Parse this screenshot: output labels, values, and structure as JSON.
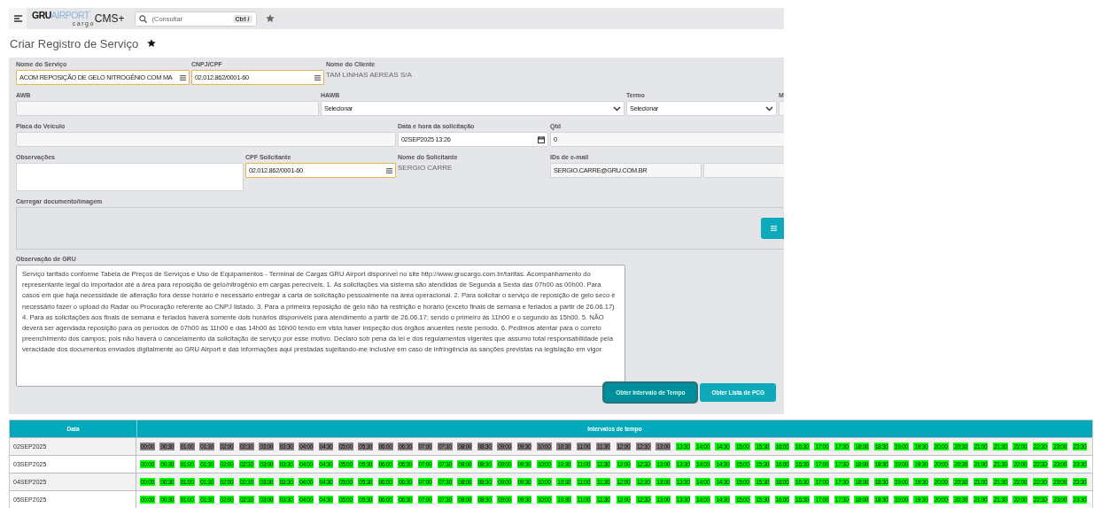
{
  "topbar": {
    "logo": {
      "brand": "GRU",
      "product": "AIRPORT",
      "sub": "cargo"
    },
    "app_name": "CMS+",
    "search": {
      "placeholder": "(Consultar",
      "shortcut": "Ctrl /"
    }
  },
  "page_title": "Criar Registro de Serviço",
  "form_rows": [
    {
      "kind": "fields",
      "fields": [
        {
          "label": "Nome do Serviço",
          "kind": "lookup",
          "value": "ACOM REPOSIÇÃO DE GELO NITROGÊNIO COM MA",
          "highlighted": true
        },
        {
          "label": "CNPJ/CPF",
          "kind": "lookup",
          "value": "02.012.862/0001-60",
          "highlighted": true
        },
        {
          "label": "Nome do Cliente",
          "kind": "static",
          "value": "TAM LINHAS AEREAS S/A"
        }
      ]
    },
    {
      "kind": "fields",
      "fields": [
        {
          "label": "AWB",
          "kind": "text",
          "highlighted": false
        },
        {
          "label": "HAWB",
          "kind": "select",
          "value": "Selecionar",
          "highlighted": false
        },
        {
          "label": "Termo",
          "kind": "select",
          "value": "Selecionar",
          "highlighted": false
        },
        {
          "label": "M",
          "kind": "text",
          "highlighted": false
        }
      ]
    },
    {
      "kind": "fields",
      "fields": [
        {
          "label": "Placa do Veículo",
          "kind": "text",
          "highlighted": false
        },
        {
          "label": "Data e hora da solicitação",
          "kind": "date",
          "value": "02SEP2025 13:26",
          "highlighted": false
        },
        {
          "label": "Qtd",
          "kind": "text",
          "value": "0",
          "highlighted": false
        }
      ]
    },
    {
      "kind": "fields",
      "fields": [
        {
          "label": "Observações",
          "kind": "textarea",
          "highlighted": false
        },
        {
          "label": "CPF Solicitante",
          "kind": "lookup",
          "value": "02.012.862/0001-60",
          "highlighted": true
        },
        {
          "label": "Nome do Solicitante",
          "kind": "static",
          "value": "SERGIO CARRE"
        },
        {
          "label": "IDs de e-mail",
          "kind": "text",
          "value": "SERGIO.CARRE@GRU.COM.BR",
          "highlighted": false
        },
        {
          "kind": "text",
          "highlighted": false
        }
      ]
    },
    {
      "kind": "upload",
      "label": "Carregar documento/imagem"
    },
    {
      "kind": "note",
      "label": "Observação de GRU",
      "value": "Serviço tarifado conforme Tabela de Preços de Serviços e Uso de Equipamentos - Terminal de Cargas GRU Airport disponível no site http://www.grucargo.com.br/tarifas. Acompanhamento do representante legal do importador até a área para reposição de gelo/nitrogênio em cargas perecíveis. 1. As solicitações via sistema são atendidas de Segunda a Sexta das 07h00 as 00h00. Para casos em que haja necessidade de alteração fora desse horário é necessário entregar a carta de solicitação pessoalmente na área operacional. 2. Para solicitar o serviço de reposição de gelo seco é necessário fazer o upload do Radar ou Procuração referente ao CNPJ listado. 3. Para a primeira reposição de gelo não há restrição e horário (exceto finais de semana e feriados a partir de 26.06.17) 4. Para as solicitações aos finais de semana e feriados haverá somente dois horários disponíveis para atendimento a partir de 26.06.17; sendo o primeiro às 11h00 e o segundo às 15h00. 5. NÃO deverá ser agendada reposição para os períodos de 07h00 às 11h00 e das 14h00 às 16h00 tendo em vista haver inspeção dos órgãos anuentes neste período. 6. Pedimos atentar para o correto preenchimento dos campos; pois não haverá o cancelamento da solicitação de serviço por esse motivo. Declaro sob pena da lei e dos regulamentos vigentes que assumo total responsabilidade pela veracidade dos documentos enviados digitalmente ao GRU Airport e das informações aqui prestadas sujeitando-me inclusive em caso de infringência às sanções previstas na legislação em vigor."
    }
  ],
  "actions": [
    {
      "label": "Obter Intervalo de Tempo",
      "focused": true
    },
    {
      "label": "Obter Lista de PCG",
      "focused": false
    }
  ],
  "table": {
    "columns": [
      "Data",
      "Intervalos de tempo"
    ],
    "rows": [
      {
        "date": "02SEP2025",
        "slots": [
          {
            "time": "00:00",
            "available": false
          },
          {
            "time": "00:30",
            "available": false
          },
          {
            "time": "01:00",
            "available": false
          },
          {
            "time": "01:30",
            "available": false
          },
          {
            "time": "02:00",
            "available": false
          },
          {
            "time": "02:30",
            "available": false
          },
          {
            "time": "03:00",
            "available": false
          },
          {
            "time": "03:30",
            "available": false
          },
          {
            "time": "04:00",
            "available": false
          },
          {
            "time": "04:30",
            "available": false
          },
          {
            "time": "05:00",
            "available": false
          },
          {
            "time": "05:30",
            "available": false
          },
          {
            "time": "06:00",
            "available": false
          },
          {
            "time": "06:30",
            "available": false
          },
          {
            "time": "07:00",
            "available": false
          },
          {
            "time": "07:30",
            "available": false
          },
          {
            "time": "08:00",
            "available": false
          },
          {
            "time": "08:30",
            "available": false
          },
          {
            "time": "09:00",
            "available": false
          },
          {
            "time": "09:30",
            "available": false
          },
          {
            "time": "10:00",
            "available": false
          },
          {
            "time": "10:30",
            "available": false
          },
          {
            "time": "11:00",
            "available": false
          },
          {
            "time": "11:30",
            "available": false
          },
          {
            "time": "12:00",
            "available": false
          },
          {
            "time": "12:30",
            "available": false
          },
          {
            "time": "13:00",
            "available": false
          },
          {
            "time": "13:30",
            "available": true
          },
          {
            "time": "14:00",
            "available": true
          },
          {
            "time": "14:30",
            "available": true
          },
          {
            "time": "15:00",
            "available": true
          },
          {
            "time": "15:30",
            "available": true
          },
          {
            "time": "16:00",
            "available": true
          },
          {
            "time": "16:30",
            "available": true
          },
          {
            "time": "17:00",
            "available": true
          },
          {
            "time": "17:30",
            "available": true
          },
          {
            "time": "18:00",
            "available": true
          },
          {
            "time": "18:30",
            "available": true
          },
          {
            "time": "19:00",
            "available": true
          },
          {
            "time": "19:30",
            "available": true
          },
          {
            "time": "20:00",
            "available": true
          },
          {
            "time": "20:30",
            "available": true
          },
          {
            "time": "21:00",
            "available": true
          },
          {
            "time": "21:30",
            "available": true
          },
          {
            "time": "22:00",
            "available": true
          },
          {
            "time": "22:30",
            "available": true
          },
          {
            "time": "23:00",
            "available": true
          },
          {
            "time": "23:30",
            "available": true
          }
        ]
      },
      {
        "date": "03SEP2025",
        "slots": [
          {
            "time": "00:00",
            "available": true
          },
          {
            "time": "00:30",
            "available": true
          },
          {
            "time": "01:00",
            "available": true
          },
          {
            "time": "01:30",
            "available": true
          },
          {
            "time": "02:00",
            "available": true
          },
          {
            "time": "02:30",
            "available": true
          },
          {
            "time": "03:00",
            "available": true
          },
          {
            "time": "03:30",
            "available": true
          },
          {
            "time": "04:00",
            "available": true
          },
          {
            "time": "04:30",
            "available": true
          },
          {
            "time": "05:00",
            "available": true
          },
          {
            "time": "05:30",
            "available": true
          },
          {
            "time": "06:00",
            "available": true
          },
          {
            "time": "06:30",
            "available": true
          },
          {
            "time": "07:00",
            "available": true
          },
          {
            "time": "07:30",
            "available": true
          },
          {
            "time": "08:00",
            "available": true
          },
          {
            "time": "08:30",
            "available": true
          },
          {
            "time": "09:00",
            "available": true
          },
          {
            "time": "09:30",
            "available": true
          },
          {
            "time": "10:00",
            "available": true
          },
          {
            "time": "10:30",
            "available": true
          },
          {
            "time": "11:00",
            "available": true
          },
          {
            "time": "11:30",
            "available": true
          },
          {
            "time": "12:00",
            "available": true
          },
          {
            "time": "12:30",
            "available": true
          },
          {
            "time": "13:00",
            "available": true
          },
          {
            "time": "13:30",
            "available": true
          },
          {
            "time": "14:00",
            "available": true
          },
          {
            "time": "14:30",
            "available": true
          },
          {
            "time": "15:00",
            "available": true
          },
          {
            "time": "15:30",
            "available": true
          },
          {
            "time": "16:00",
            "available": true
          },
          {
            "time": "16:30",
            "available": true
          },
          {
            "time": "17:00",
            "available": true
          },
          {
            "time": "17:30",
            "available": true
          },
          {
            "time": "18:00",
            "available": true
          },
          {
            "time": "18:30",
            "available": true
          },
          {
            "time": "19:00",
            "available": true
          },
          {
            "time": "19:30",
            "available": true
          },
          {
            "time": "20:00",
            "available": true
          },
          {
            "time": "20:30",
            "available": true
          },
          {
            "time": "21:00",
            "available": true
          },
          {
            "time": "21:30",
            "available": true
          },
          {
            "time": "22:00",
            "available": true
          },
          {
            "time": "22:30",
            "available": true
          },
          {
            "time": "23:00",
            "available": true
          },
          {
            "time": "23:30",
            "available": true
          }
        ]
      },
      {
        "date": "04SEP2025",
        "slots": [
          {
            "time": "00:00",
            "available": true
          },
          {
            "time": "00:30",
            "available": true
          },
          {
            "time": "01:00",
            "available": true
          },
          {
            "time": "01:30",
            "available": true
          },
          {
            "time": "02:00",
            "available": true
          },
          {
            "time": "02:30",
            "available": true
          },
          {
            "time": "03:00",
            "available": true
          },
          {
            "time": "03:30",
            "available": true
          },
          {
            "time": "04:00",
            "available": true
          },
          {
            "time": "04:30",
            "available": true
          },
          {
            "time": "05:00",
            "available": true
          },
          {
            "time": "05:30",
            "available": true
          },
          {
            "time": "06:00",
            "available": true
          },
          {
            "time": "06:30",
            "available": true
          },
          {
            "time": "07:00",
            "available": true
          },
          {
            "time": "07:30",
            "available": true
          },
          {
            "time": "08:00",
            "available": true
          },
          {
            "time": "08:30",
            "available": true
          },
          {
            "time": "09:00",
            "available": true
          },
          {
            "time": "09:30",
            "available": true
          },
          {
            "time": "10:00",
            "available": true
          },
          {
            "time": "10:30",
            "available": true
          },
          {
            "time": "11:00",
            "available": true
          },
          {
            "time": "11:30",
            "available": true
          },
          {
            "time": "12:00",
            "available": true
          },
          {
            "time": "12:30",
            "available": true
          },
          {
            "time": "13:00",
            "available": true
          },
          {
            "time": "13:30",
            "available": true
          },
          {
            "time": "14:00",
            "available": true
          },
          {
            "time": "14:30",
            "available": true
          },
          {
            "time": "15:00",
            "available": true
          },
          {
            "time": "15:30",
            "available": true
          },
          {
            "time": "16:00",
            "available": true
          },
          {
            "time": "16:30",
            "available": true
          },
          {
            "time": "17:00",
            "available": true
          },
          {
            "time": "17:30",
            "available": true
          },
          {
            "time": "18:00",
            "available": true
          },
          {
            "time": "18:30",
            "available": true
          },
          {
            "time": "19:00",
            "available": true
          },
          {
            "time": "19:30",
            "available": true
          },
          {
            "time": "20:00",
            "available": true
          },
          {
            "time": "20:30",
            "available": true
          },
          {
            "time": "21:00",
            "available": true
          },
          {
            "time": "21:30",
            "available": true
          },
          {
            "time": "22:00",
            "available": true
          },
          {
            "time": "22:30",
            "available": true
          },
          {
            "time": "23:00",
            "available": true
          },
          {
            "time": "23:30",
            "available": true
          }
        ]
      },
      {
        "date": "05SEP2025",
        "slots": [
          {
            "time": "00:00",
            "available": true
          },
          {
            "time": "00:30",
            "available": true
          },
          {
            "time": "01:00",
            "available": true
          },
          {
            "time": "01:30",
            "available": true
          },
          {
            "time": "02:00",
            "available": true
          },
          {
            "time": "02:30",
            "available": true
          },
          {
            "time": "03:00",
            "available": true
          },
          {
            "time": "03:30",
            "available": true
          },
          {
            "time": "04:00",
            "available": true
          },
          {
            "time": "04:30",
            "available": true
          },
          {
            "time": "05:00",
            "available": true
          },
          {
            "time": "05:30",
            "available": true
          },
          {
            "time": "06:00",
            "available": true
          },
          {
            "time": "06:30",
            "available": true
          },
          {
            "time": "07:00",
            "available": true
          },
          {
            "time": "07:30",
            "available": true
          },
          {
            "time": "08:00",
            "available": true
          },
          {
            "time": "08:30",
            "available": true
          },
          {
            "time": "09:00",
            "available": true
          },
          {
            "time": "09:30",
            "available": true
          },
          {
            "time": "10:00",
            "available": true
          },
          {
            "time": "10:30",
            "available": true
          },
          {
            "time": "11:00",
            "available": true
          },
          {
            "time": "11:30",
            "available": true
          },
          {
            "time": "12:00",
            "available": true
          },
          {
            "time": "12:30",
            "available": true
          },
          {
            "time": "13:00",
            "available": true
          },
          {
            "time": "13:30",
            "available": true
          },
          {
            "time": "14:00",
            "available": true
          },
          {
            "time": "14:30",
            "available": true
          },
          {
            "time": "15:00",
            "available": true
          },
          {
            "time": "15:30",
            "available": true
          },
          {
            "time": "16:00",
            "available": true
          },
          {
            "time": "16:30",
            "available": true
          },
          {
            "time": "17:00",
            "available": true
          },
          {
            "time": "17:30",
            "available": true
          },
          {
            "time": "18:00",
            "available": true
          },
          {
            "time": "18:30",
            "available": true
          },
          {
            "time": "19:00",
            "available": true
          },
          {
            "time": "19:30",
            "available": true
          },
          {
            "time": "20:00",
            "available": true
          },
          {
            "time": "20:30",
            "available": true
          },
          {
            "time": "21:00",
            "available": true
          },
          {
            "time": "21:30",
            "available": true
          },
          {
            "time": "22:00",
            "available": true
          },
          {
            "time": "22:30",
            "available": true
          },
          {
            "time": "23:00",
            "available": true
          },
          {
            "time": "23:30",
            "available": true
          }
        ]
      }
    ]
  }
}
